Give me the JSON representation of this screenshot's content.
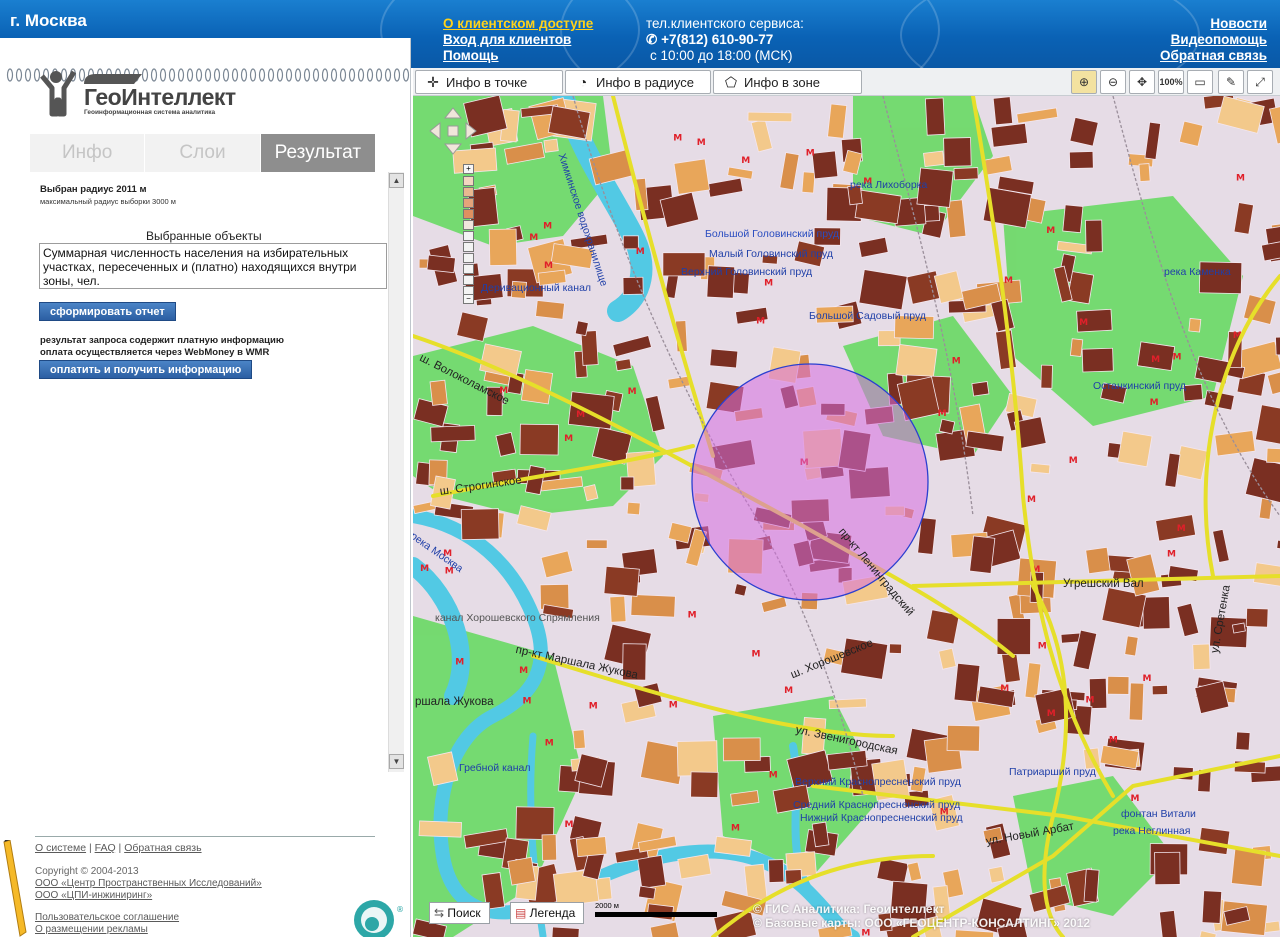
{
  "header": {
    "city": "г. Москва",
    "links_left": [
      "О клиентском доступе",
      "Вход для клиентов",
      "Помощь"
    ],
    "service_label": "тел.клиентского сервиса:",
    "phone": "+7(812) 610-90-77",
    "hours": "с 10:00 до 18:00 (МСК)",
    "links_right": [
      "Новости",
      "Видеопомощь",
      "Обратная связь"
    ]
  },
  "logo": {
    "title": "ГеоИнтеллект",
    "subtitle": "Геоинформационная система аналитика"
  },
  "tabs": [
    "Инфо",
    "Слои",
    "Результат"
  ],
  "result": {
    "radius_label": "Выбран радиус 2011 м",
    "max_radius": "максимальный радиус выборки 3000 м",
    "selected_heading": "Выбранные объекты",
    "selected_text": "Суммарная численность населения на избирательных участках, пересеченных и   (платно) находящихся внутри зоны, чел.",
    "report_button": "сформировать отчет",
    "paid_note_1": "результат запроса содержит платную информацию",
    "paid_note_2": "оплата осуществляется через WebMoney в WMR",
    "pay_button": "оплатить и получить информацию"
  },
  "footer": {
    "links": [
      "О системе",
      "FAQ",
      "Обратная связь"
    ],
    "copyright": "Copyright © 2004-2013",
    "org1": "ООО «Центр Пространственных Исследований»",
    "org2": "ООО «ЦПИ-инжиниринг»",
    "agreement": "Пользовательское соглашение",
    "ads": "О размещении рекламы"
  },
  "map_toolbar": {
    "tools": [
      "Инфо в точке",
      "Инфо в радиусе",
      "Инфо в зоне"
    ],
    "zoom_full": "100%"
  },
  "map": {
    "search_button": "Поиск",
    "legend_button": "Легенда",
    "scale": "2000 м",
    "copyright_1": "© ГИС Аналитика: Геоинтеллект",
    "copyright_2": "© Базовые карты: ООО «ГЕОЦЕНТР-КОНСАЛТИНГ»  2012",
    "labels": [
      "река Лихоборка",
      "Большой Головинский пруд",
      "Малый Головинский пруд",
      "Верхний Головинский пруд",
      "Большой Садовый пруд",
      "Деривационный канал",
      "река Каменка",
      "Останкинский пруд",
      "Химкинское водохранилище",
      "ш. Волоколамское",
      "ш. Строгинское",
      "река Москва",
      "канал Хорошевского Спрямления",
      "пр-кт Маршала Жукова",
      "ршала Жукова",
      "Гребной канал",
      "ул. Звенигородская",
      "ш. Хорошевское",
      "пр-кт Ленинградский",
      "Угрешский Вал",
      "Верхний Краснопресненский пруд",
      "Средний Краснопресненский пруд",
      "Нижний Краснопресненский пруд",
      "Патриарший пруд",
      "ул. Новый Арбат",
      "фонтан Витали",
      "река Неглинная",
      "ул. Сретенка"
    ]
  },
  "colors": {
    "header_blue": "#0a62b5",
    "active_link": "#ffd21a",
    "block_brown": "#7a2f22",
    "block_orange": "#e8a65a",
    "park_green": "#6fd96a",
    "water_cyan": "#52c9e4",
    "road_yellow": "#e6df2a",
    "radius_fill": "#d66de0"
  }
}
